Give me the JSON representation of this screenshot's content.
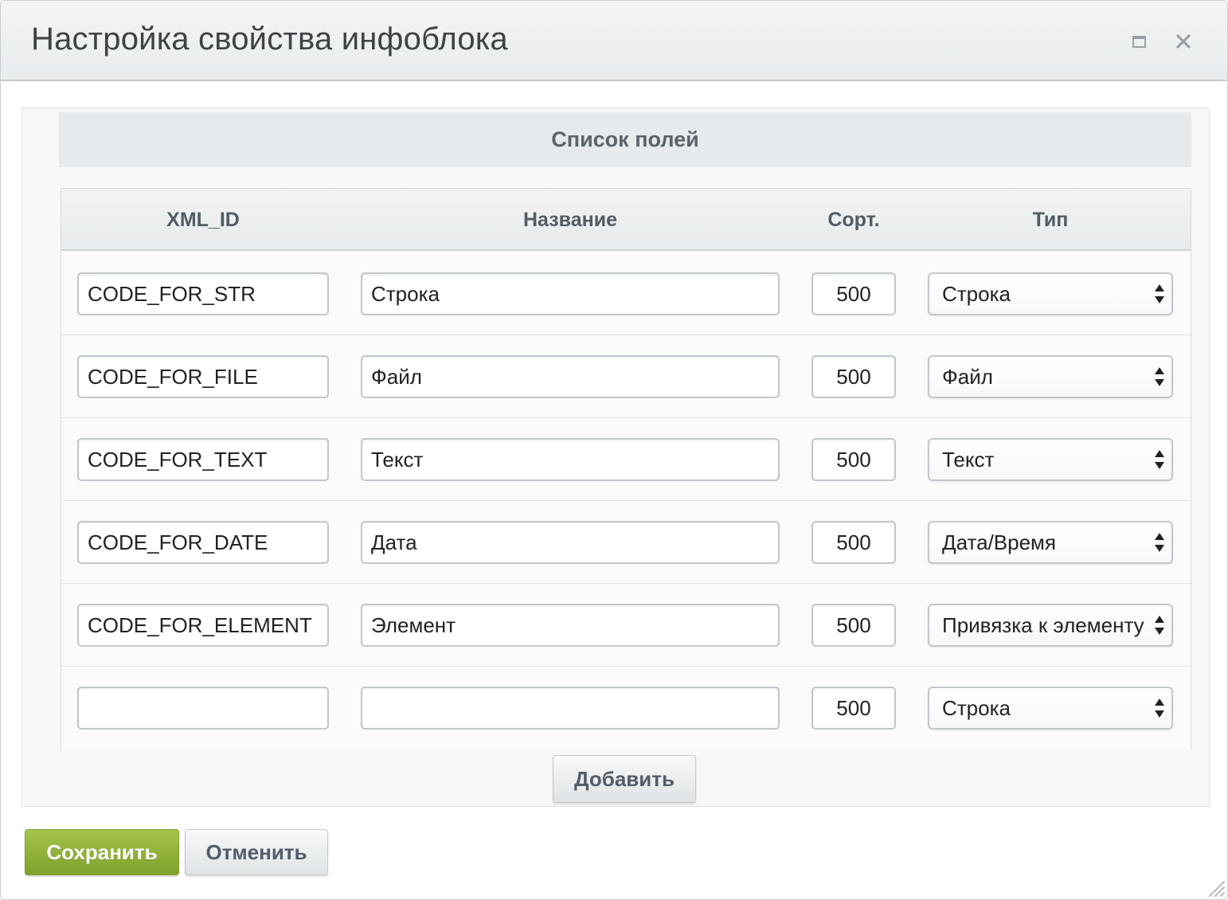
{
  "dialog": {
    "title": "Настройка свойства инфоблока",
    "controls": {
      "maximize_icon": "maximize-icon",
      "close_icon": "close-icon"
    }
  },
  "section": {
    "title": "Список полей"
  },
  "table": {
    "columns": {
      "xml_id": "XML_ID",
      "name": "Название",
      "sort": "Сорт.",
      "type": "Тип"
    },
    "rows": [
      {
        "xml_id": "CODE_FOR_STR",
        "name": "Строка",
        "sort": "500",
        "type": "Строка"
      },
      {
        "xml_id": "CODE_FOR_FILE",
        "name": "Файл",
        "sort": "500",
        "type": "Файл"
      },
      {
        "xml_id": "CODE_FOR_TEXT",
        "name": "Текст",
        "sort": "500",
        "type": "Текст"
      },
      {
        "xml_id": "CODE_FOR_DATE",
        "name": "Дата",
        "sort": "500",
        "type": "Дата/Время"
      },
      {
        "xml_id": "CODE_FOR_ELEMENT",
        "name": "Элемент",
        "sort": "500",
        "type": "Привязка к элементу"
      },
      {
        "xml_id": "",
        "name": "",
        "sort": "500",
        "type": "Строка"
      }
    ]
  },
  "buttons": {
    "add": "Добавить",
    "save": "Сохранить",
    "cancel": "Отменить"
  },
  "colors": {
    "accent_save": "#8cad36",
    "header_bg": "#e6eaec",
    "border": "#c2c7cc"
  }
}
